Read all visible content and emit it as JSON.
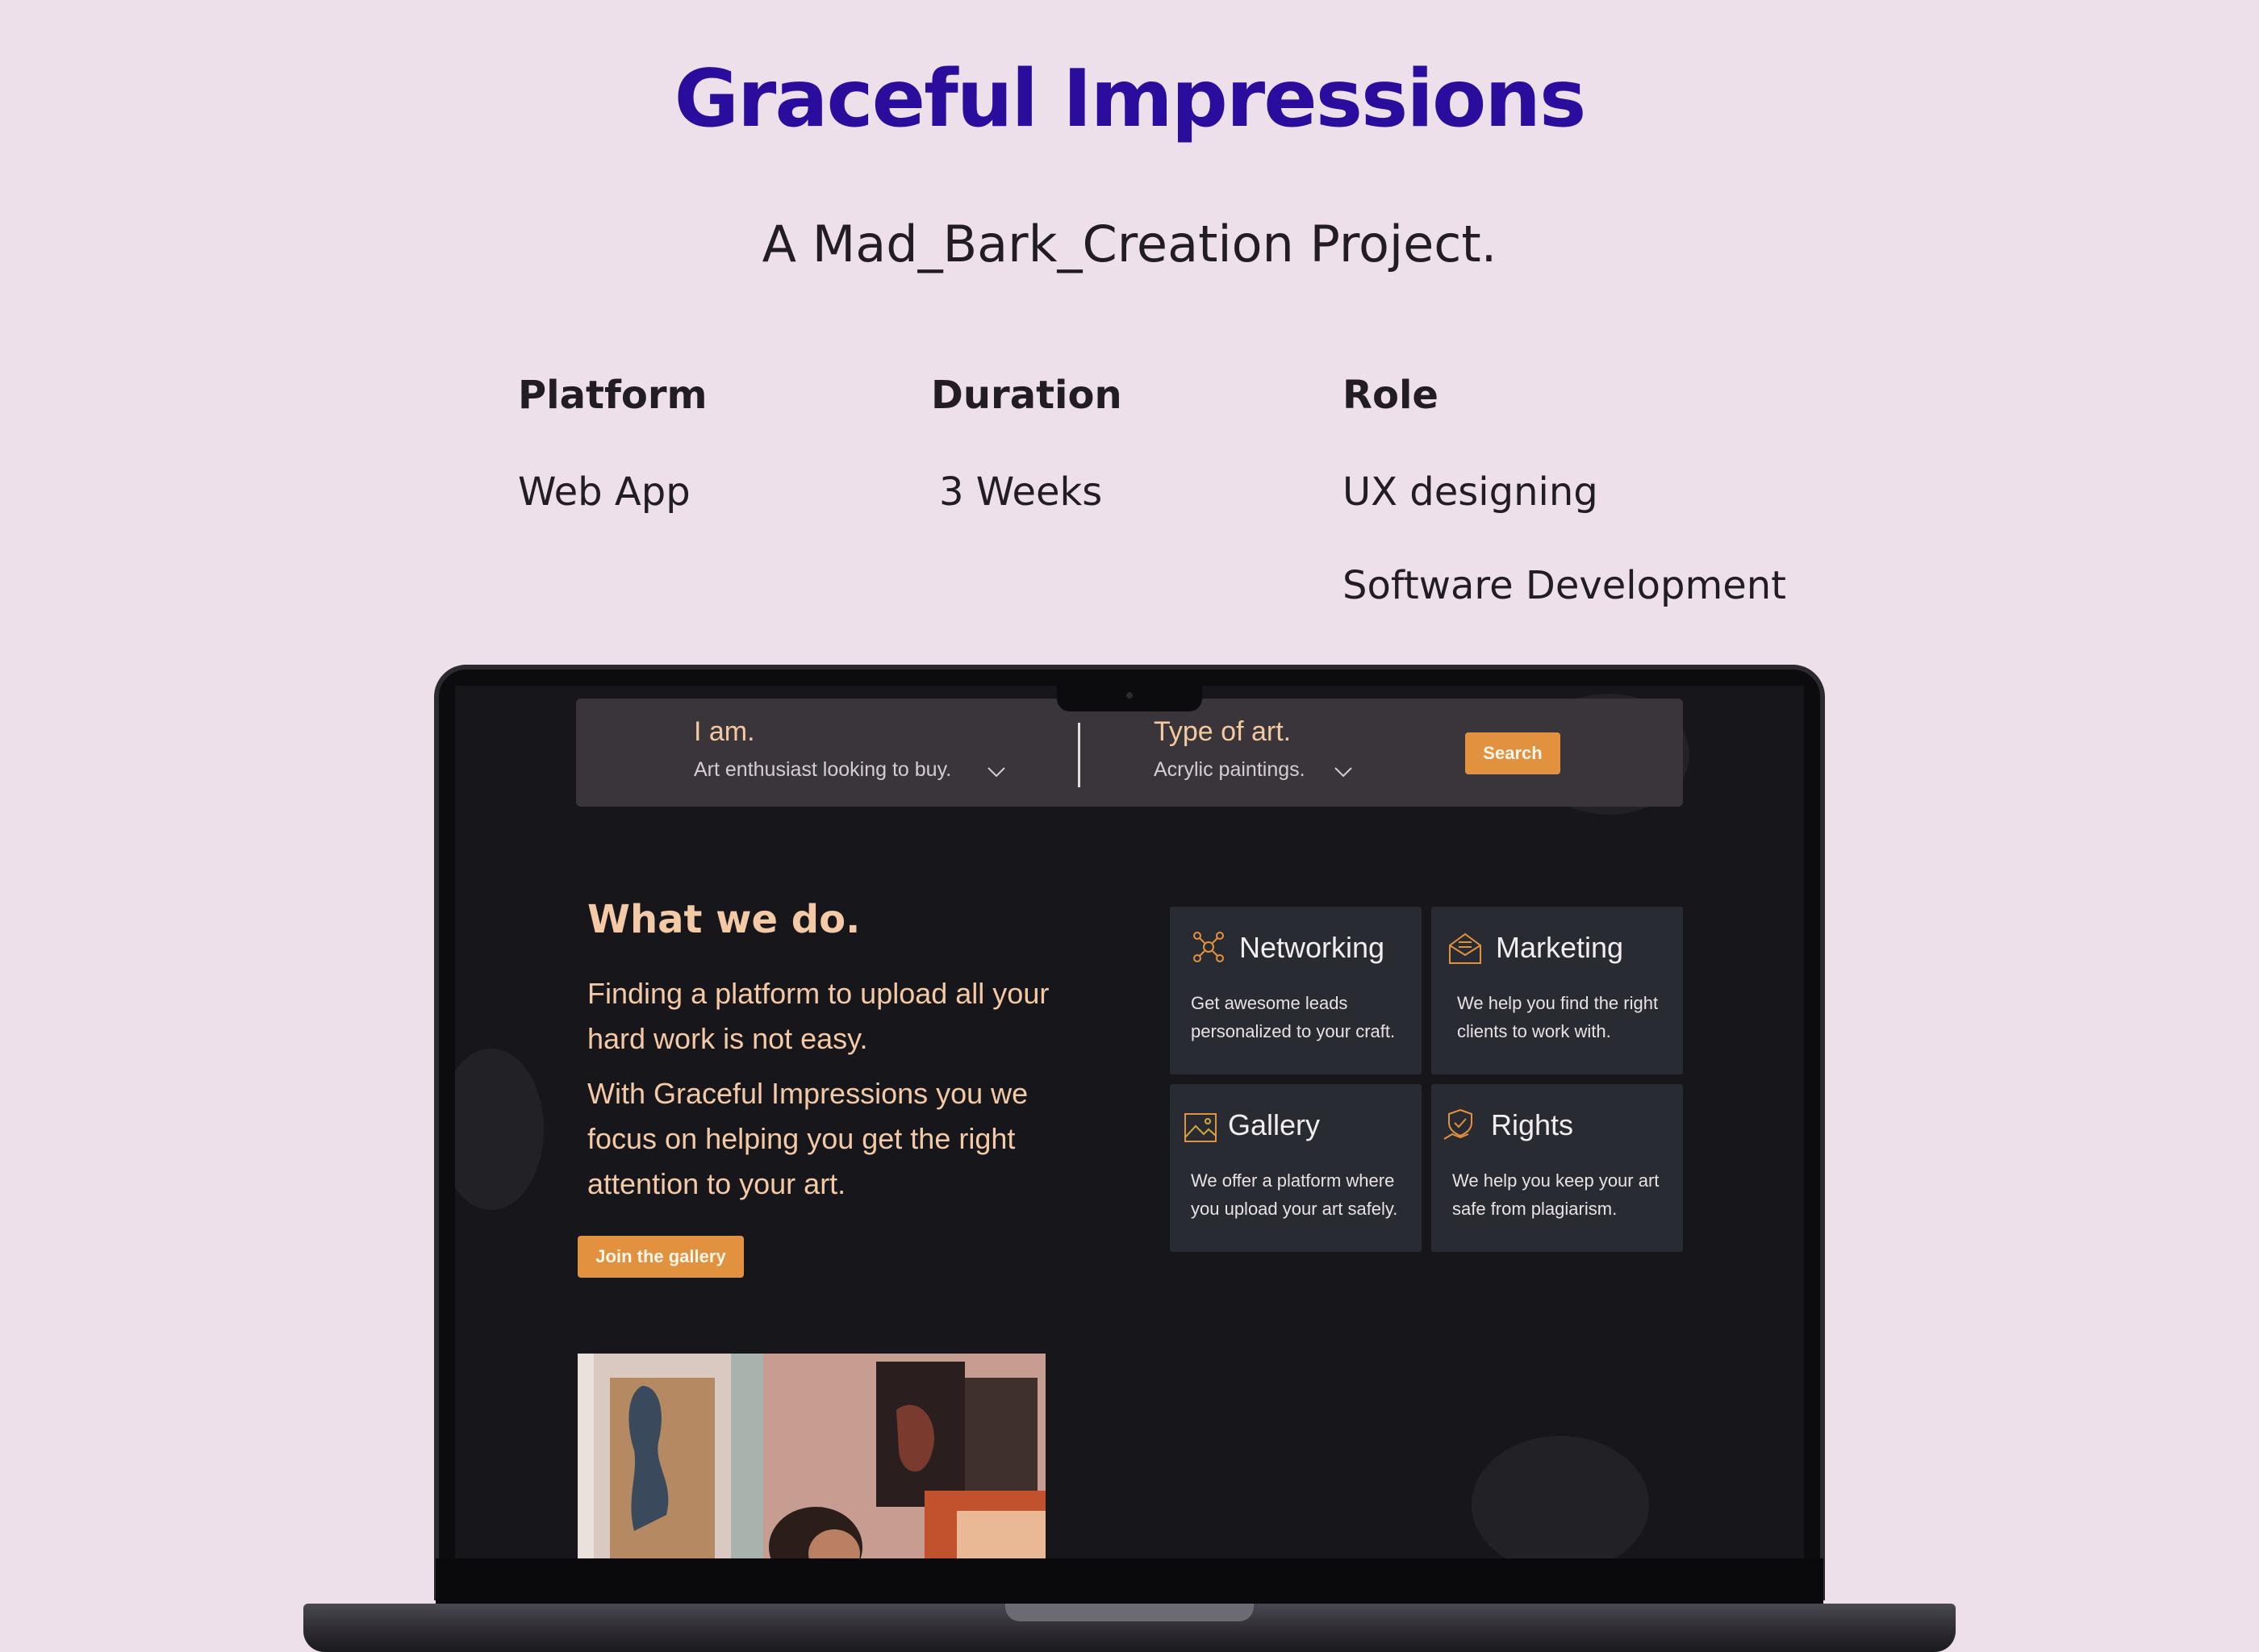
{
  "header": {
    "title": "Graceful Impressions",
    "subtitle": "A Mad_Bark_Creation Project."
  },
  "meta": {
    "platform": {
      "label": "Platform",
      "value": "Web App"
    },
    "duration": {
      "label": "Duration",
      "value": "3 Weeks"
    },
    "role": {
      "label": "Role",
      "values": [
        "UX designing",
        "Software Development"
      ]
    }
  },
  "site": {
    "search": {
      "iam_label": "I am.",
      "iam_value": "Art enthusiast looking to buy.",
      "type_label": "Type of art.",
      "type_value": "Acrylic paintings.",
      "button": "Search"
    },
    "what_we_do": {
      "title": "What we do.",
      "p1": "Finding a platform to upload all your hard work is not easy.",
      "p2": "With Graceful Impressions you we focus on helping you get the right attention to your art.",
      "button": "Join the gallery"
    },
    "cards": [
      {
        "title": "Networking",
        "desc": "Get awesome leads personalized to your craft.",
        "icon": "networking-icon"
      },
      {
        "title": "Marketing",
        "desc": "We help you find the right clients to work with.",
        "icon": "marketing-icon"
      },
      {
        "title": "Gallery",
        "desc": "We offer a platform where you upload your art safely.",
        "icon": "gallery-icon"
      },
      {
        "title": "Rights",
        "desc": "We help you keep your art safe from plagiarism.",
        "icon": "rights-icon"
      }
    ]
  },
  "colors": {
    "page_bg": "#ede0ea",
    "title": "#2a0d9c",
    "accent": "#e2923e",
    "site_bg": "#17171b",
    "card_bg": "#292b33",
    "peach_text": "#f4c9a6"
  }
}
